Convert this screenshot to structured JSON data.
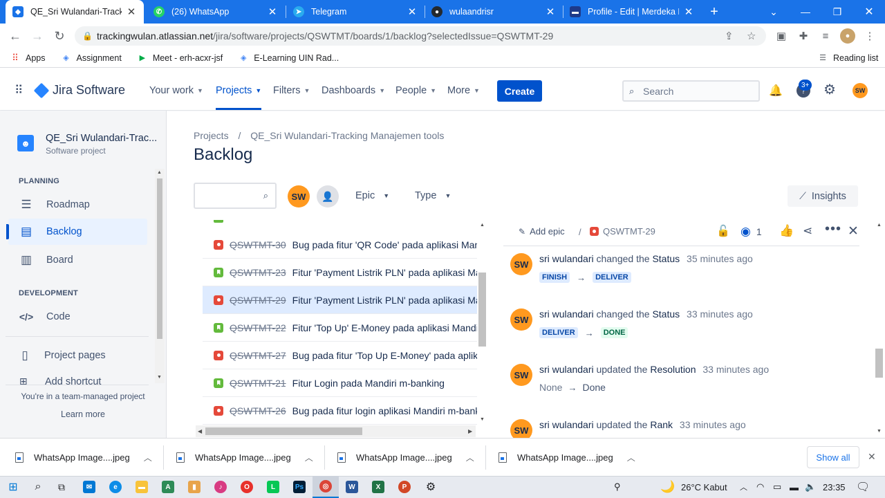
{
  "browser": {
    "tabs": [
      {
        "title": "QE_Sri Wulandari-Tracking",
        "favicon": "jira-icon",
        "color": "#1a73e8",
        "active": true
      },
      {
        "title": "(26) WhatsApp",
        "favicon": "whatsapp-icon",
        "color": "#25d366",
        "active": false
      },
      {
        "title": "Telegram",
        "favicon": "telegram-icon",
        "color": "#2aabee",
        "active": false
      },
      {
        "title": "wulaandrisr",
        "favicon": "github-icon",
        "color": "#24292e",
        "active": false
      },
      {
        "title": "Profile - Edit | Merdeka Be",
        "favicon": "merdeka-icon",
        "color": "#1e3a8a",
        "active": false
      }
    ],
    "url_domain": "trackingwulan.atlassian.net",
    "url_path": "/jira/software/projects/QSWTMT/boards/1/backlog?selectedIssue=QSWTMT-29",
    "bookmarks": [
      {
        "label": "Apps",
        "icon": "apps-grid-icon"
      },
      {
        "label": "Assignment",
        "icon": "assignment-icon"
      },
      {
        "label": "Meet - erh-acxr-jsf",
        "icon": "meet-icon"
      },
      {
        "label": "E-Learning UIN Rad...",
        "icon": "elearning-icon"
      }
    ],
    "reading_list": "Reading list"
  },
  "jira_nav": {
    "logo_text": "Jira Software",
    "items": [
      {
        "label": "Your work"
      },
      {
        "label": "Projects"
      },
      {
        "label": "Filters"
      },
      {
        "label": "Dashboards"
      },
      {
        "label": "People"
      },
      {
        "label": "More"
      }
    ],
    "create_label": "Create",
    "search_placeholder": "Search",
    "help_badge": "3+",
    "user_initials": "SW"
  },
  "sidebar": {
    "project_name": "QE_Sri Wulandari-Trac...",
    "project_type": "Software project",
    "planning_heading": "PLANNING",
    "planning_items": [
      {
        "label": "Roadmap",
        "icon": "roadmap-icon"
      },
      {
        "label": "Backlog",
        "icon": "backlog-icon"
      },
      {
        "label": "Board",
        "icon": "board-icon"
      }
    ],
    "development_heading": "DEVELOPMENT",
    "development_items": [
      {
        "label": "Code",
        "icon": "code-icon"
      }
    ],
    "project_pages": "Project pages",
    "add_shortcut": "Add shortcut",
    "team_note": "You're in a team-managed project",
    "learn_more": "Learn more"
  },
  "main": {
    "breadcrumb_root": "Projects",
    "breadcrumb_sep": "/",
    "breadcrumb_project": "QE_Sri Wulandari-Tracking Manajemen tools",
    "title": "Backlog",
    "avatar_initials": "SW",
    "epic_filter": "Epic",
    "type_filter": "Type",
    "insights_label": "Insights"
  },
  "backlog": {
    "rows": [
      {
        "type": "bug",
        "key": "QSWTMT-30",
        "summary": "Bug pada fitur 'QR Code' pada aplikasi Mandiri m-banking",
        "selected": false
      },
      {
        "type": "story",
        "key": "QSWTMT-23",
        "summary": "Fitur 'Payment Listrik PLN' pada aplikasi Mandiri m-banking",
        "selected": false
      },
      {
        "type": "bug",
        "key": "QSWTMT-29",
        "summary": "Fitur 'Payment Listrik PLN' pada aplikasi Mandiri m-banking",
        "selected": true
      },
      {
        "type": "story",
        "key": "QSWTMT-22",
        "summary": "Fitur 'Top Up' E-Money pada aplikasi Mandiri m-banking",
        "selected": false
      },
      {
        "type": "bug",
        "key": "QSWTMT-27",
        "summary": "Bug pada fitur 'Top Up E-Money' pada aplikasi Mandiri",
        "selected": false
      },
      {
        "type": "story",
        "key": "QSWTMT-21",
        "summary": "Fitur Login pada Mandiri m-banking",
        "selected": false
      },
      {
        "type": "bug",
        "key": "QSWTMT-26",
        "summary": "Bug pada fitur login aplikasi Mandiri m-banking",
        "selected": false
      }
    ]
  },
  "detail": {
    "add_epic": "Add epic",
    "sep": "/",
    "issue_key": "QSWTMT-29",
    "watch_count": "1",
    "activity": [
      {
        "user": "sri wulandari",
        "verb": "changed the",
        "field": "Status",
        "time": "35 minutes ago",
        "from": "FINISH",
        "arrow": "→",
        "to": "DELIVER",
        "from_style": "blue",
        "to_style": "blue"
      },
      {
        "user": "sri wulandari",
        "verb": "changed the",
        "field": "Status",
        "time": "33 minutes ago",
        "from": "DELIVER",
        "arrow": "→",
        "to": "DONE",
        "from_style": "blue",
        "to_style": "green"
      },
      {
        "user": "sri wulandari",
        "verb": "updated the",
        "field": "Resolution",
        "time": "33 minutes ago",
        "from": "None",
        "arrow": "→",
        "to": "Done",
        "from_style": "plain",
        "to_style": "plain"
      },
      {
        "user": "sri wulandari",
        "verb": "updated the",
        "field": "Rank",
        "time": "33 minutes ago"
      }
    ],
    "activity_initials": "SW"
  },
  "downloads": {
    "items": [
      {
        "name": "WhatsApp Image....jpeg"
      },
      {
        "name": "WhatsApp Image....jpeg"
      },
      {
        "name": "WhatsApp Image....jpeg"
      },
      {
        "name": "WhatsApp Image....jpeg"
      }
    ],
    "show_all": "Show all"
  },
  "taskbar": {
    "weather": "26°C  Kabut",
    "time": "23:35"
  },
  "colors": {
    "chrome_blue": "#1a73e8",
    "jira_blue": "#0052cc",
    "avatar_orange": "#ff991f",
    "bug_red": "#e5493a",
    "story_green": "#63ba3c"
  }
}
